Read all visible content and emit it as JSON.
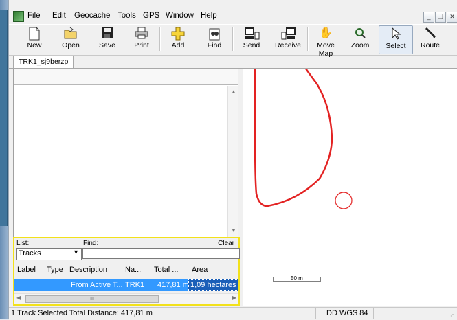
{
  "menu": [
    "File",
    "Edit",
    "Geocache",
    "Tools",
    "GPS",
    "Window",
    "Help"
  ],
  "window_buttons": [
    "_",
    "ə",
    "x"
  ],
  "toolbar": [
    {
      "label": "New",
      "icon": "new-file-icon",
      "glyph": "🗋"
    },
    {
      "label": "Open",
      "icon": "open-folder-icon",
      "glyph": "📂"
    },
    {
      "label": "Save",
      "icon": "save-disk-icon",
      "glyph": "💾"
    },
    {
      "label": "Print",
      "icon": "printer-icon",
      "glyph": "🖨"
    },
    {
      "label": "Add",
      "icon": "add-plus-icon",
      "glyph": "✚"
    },
    {
      "label": "Find",
      "icon": "find-binoculars-icon",
      "glyph": "🔭"
    },
    {
      "label": "Send",
      "icon": "send-to-gps-icon",
      "glyph": "📤"
    },
    {
      "label": "Receive",
      "icon": "receive-from-gps-icon",
      "glyph": "📥"
    },
    {
      "label": "Move Map",
      "icon": "hand-pan-icon",
      "glyph": "✋"
    },
    {
      "label": "Zoom",
      "icon": "zoom-magnifier-icon",
      "glyph": "🔍"
    },
    {
      "label": "Select",
      "icon": "select-arrow-icon",
      "glyph": "↖"
    },
    {
      "label": "Route",
      "icon": "route-pencil-icon",
      "glyph": "✎"
    }
  ],
  "tab": {
    "label": "TRK1_sj9berzp"
  },
  "list_panel": {
    "list_label": "List:",
    "find_label": "Find:",
    "clear_label": "Clear",
    "list_value": "Tracks",
    "find_value": "",
    "columns": [
      "Label",
      "Type",
      "Description",
      "Na...",
      "Total ...",
      "Area"
    ],
    "row": {
      "label": "",
      "type": "",
      "description": "From Active T...",
      "name": "TRK1",
      "total": "417,81 m",
      "area": "1,09 hectares"
    },
    "hscroll_grip": "III"
  },
  "map": {
    "scale_label": "50 m",
    "track_color": "#e32222"
  },
  "status": {
    "text": "1 Track Selected Total Distance: 417,81 m",
    "datum": "DD WGS 84"
  },
  "colors": {
    "selection": "#3399ff",
    "panel_highlight": "#f2e11b"
  }
}
